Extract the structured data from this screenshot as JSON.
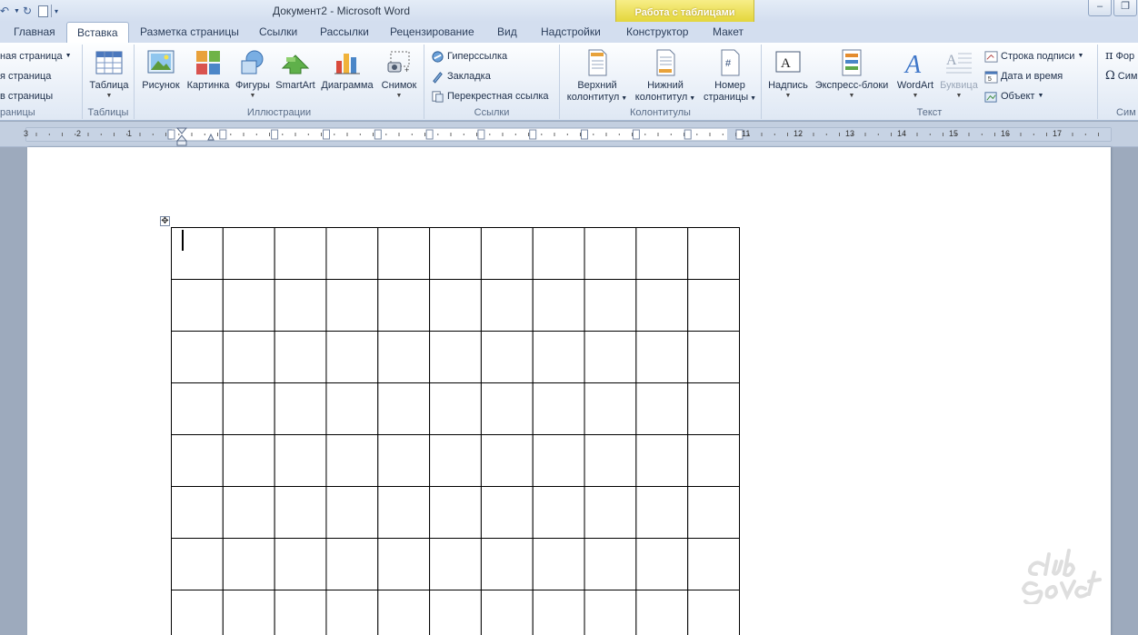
{
  "window": {
    "title": "Документ2 - Microsoft Word",
    "context_header": "Работа с таблицами",
    "minimize_glyph": "–",
    "restore_glyph": "❐"
  },
  "tabs": [
    "Главная",
    "Вставка",
    "Разметка страницы",
    "Ссылки",
    "Рассылки",
    "Рецензирование",
    "Вид",
    "Надстройки",
    "Конструктор",
    "Макет"
  ],
  "active_tab": "Вставка",
  "ribbon": {
    "pages": {
      "items": [
        "ная страница",
        "я страница",
        "в страницы"
      ],
      "label": "раницы"
    },
    "tables": {
      "button": "Таблица",
      "label": "Таблицы"
    },
    "illustrations": {
      "buttons": [
        "Рисунок",
        "Картинка",
        "Фигуры",
        "SmartArt",
        "Диаграмма",
        "Снимок"
      ],
      "label": "Иллюстрации"
    },
    "links": {
      "items": [
        "Гиперссылка",
        "Закладка",
        "Перекрестная ссылка"
      ],
      "label": "Ссылки"
    },
    "header_footer": {
      "header_line1": "Верхний",
      "header_line2": "колонтитул",
      "footer_line1": "Нижний",
      "footer_line2": "колонтитул",
      "pagenum_line1": "Номер",
      "pagenum_line2": "страницы",
      "label": "Колонтитулы"
    },
    "text": {
      "buttons": [
        "Надпись",
        "Экспресс-блоки",
        "WordArt",
        "Буквица"
      ],
      "small": [
        "Строка подписи",
        "Дата и время",
        "Объект"
      ],
      "label": "Текст"
    },
    "symbols": {
      "items": [
        "Фор",
        "Сим"
      ],
      "label": "Сим"
    }
  },
  "ruler": {
    "left_numbers": [
      "3",
      "2",
      "1"
    ],
    "right_numbers": [
      "11",
      "12",
      "13",
      "14",
      "15",
      "16",
      "17"
    ]
  },
  "document": {
    "table": {
      "rows": 8,
      "cols": 11
    },
    "table_move_glyph": "✥"
  },
  "watermark": "club Sovet",
  "colors": {
    "ribbon_bg": "#eaf0f8",
    "context_tab": "#e6d944",
    "workspace": "#9daabd"
  }
}
